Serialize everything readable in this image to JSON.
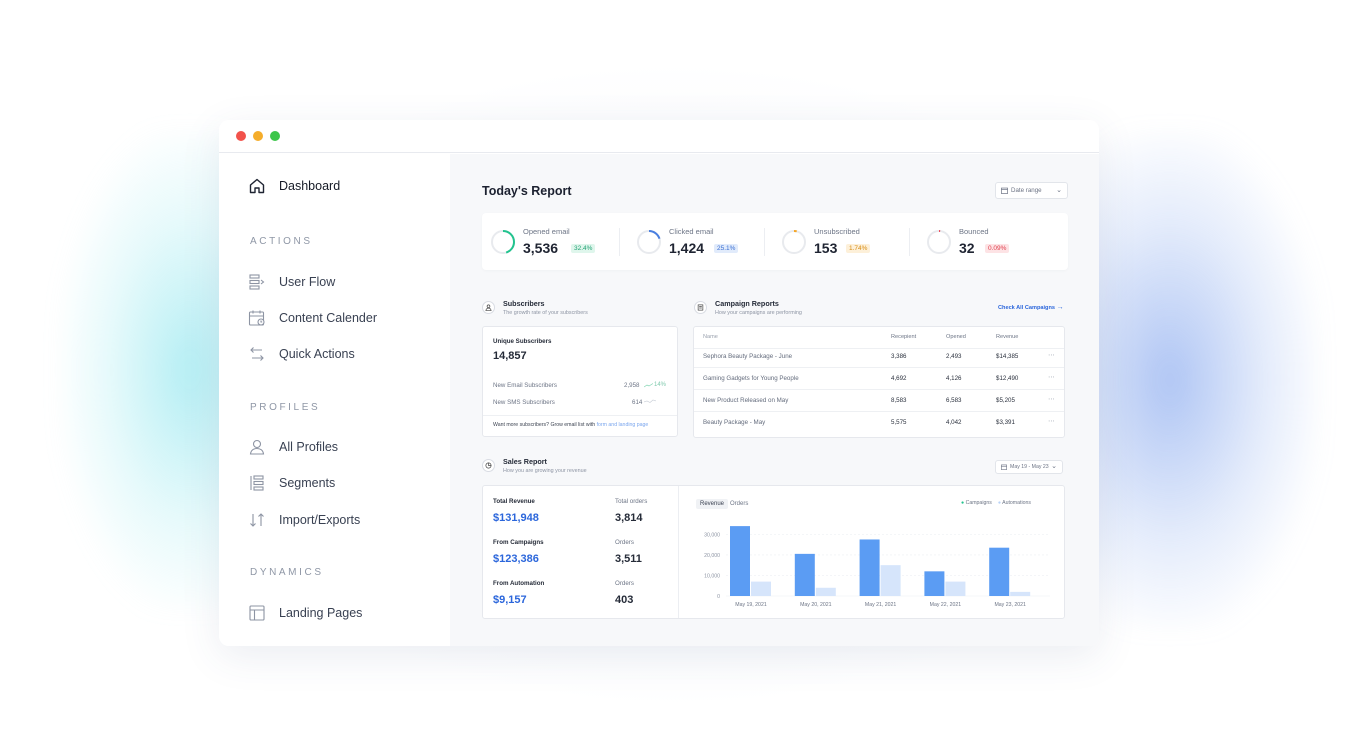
{
  "sidebar": {
    "dashboard": "Dashboard",
    "sections": {
      "actions": "ACTIONS",
      "profiles": "PROFILES",
      "dynamics": "DYNAMICS"
    },
    "items": {
      "user_flow": "User Flow",
      "content_calendar": "Content Calender",
      "quick_actions": "Quick Actions",
      "all_profiles": "All Profiles",
      "segments": "Segments",
      "import_exports": "Import/Exports",
      "landing_pages": "Landing Pages"
    }
  },
  "header": {
    "title": "Today's Report",
    "date_range": "Date range"
  },
  "kpis": [
    {
      "label": "Opened email",
      "value": "3,536",
      "badge": "32.4%",
      "ring_fraction": 0.45,
      "color": "#22c38e",
      "badge_bg": "#dff6ec",
      "badge_fg": "#22a274"
    },
    {
      "label": "Clicked email",
      "value": "1,424",
      "badge": "25.1%",
      "ring_fraction": 0.2,
      "color": "#4a7fe0",
      "badge_bg": "#e1ebfb",
      "badge_fg": "#3a6fd3"
    },
    {
      "label": "Unsubscribed",
      "value": "153",
      "badge": "1.74%",
      "ring_fraction": 0.04,
      "color": "#f5a524",
      "badge_bg": "#fdf0d9",
      "badge_fg": "#d88c12"
    },
    {
      "label": "Bounced",
      "value": "32",
      "badge": "0.09%",
      "ring_fraction": 0.01,
      "color": "#ef4b5a",
      "badge_bg": "#fde3e5",
      "badge_fg": "#e0404e"
    }
  ],
  "subscribers": {
    "title": "Subscribers",
    "subtitle": "The growth rate of your subscribers",
    "unique_label": "Unique Subscribers",
    "unique_value": "14,857",
    "new_email_label": "New Email Subscribers",
    "new_email_value": "2,958",
    "new_email_change": "14%",
    "new_sms_label": "New SMS Subscribers",
    "new_sms_value": "614",
    "footer_text": "Want more subscribers? Grow email list with",
    "footer_link": "form and landing page"
  },
  "campaigns": {
    "title": "Campaign Reports",
    "subtitle": "How your campaigns are performing",
    "link": "Check All Campaigns",
    "columns": [
      "Name",
      "Recepient",
      "Opened",
      "Revenue"
    ],
    "rows": [
      {
        "name": "Sephora Beauty Package - June",
        "recipient": "3,386",
        "opened": "2,493",
        "revenue": "$14,385"
      },
      {
        "name": "Gaming Gadgets for Young People",
        "recipient": "4,692",
        "opened": "4,126",
        "revenue": "$12,490"
      },
      {
        "name": "New Product Released on May",
        "recipient": "8,583",
        "opened": "6,583",
        "revenue": "$5,205"
      },
      {
        "name": "Beauty Package - May",
        "recipient": "5,575",
        "opened": "4,042",
        "revenue": "$3,391"
      }
    ]
  },
  "sales": {
    "title": "Sales Report",
    "subtitle": "How you are growing your revenue",
    "date_range": "May 19 - May 23",
    "total_revenue_label": "Total Revenue",
    "total_revenue": "$131,948",
    "total_orders_label": "Total orders",
    "total_orders": "3,814",
    "from_campaigns_label": "From Campaigns",
    "from_campaigns": "$123,386",
    "campaign_orders_label": "Orders",
    "campaign_orders": "3,511",
    "from_automation_label": "From Automation",
    "from_automation": "$9,157",
    "automation_orders_label": "Orders",
    "automation_orders": "403",
    "tabs": [
      "Revenue",
      "Orders"
    ]
  },
  "chart_data": {
    "type": "bar",
    "categories": [
      "May 19, 2021",
      "May 20, 2021",
      "May 21, 2021",
      "May 22, 2021",
      "May 23, 2021"
    ],
    "series": [
      {
        "name": "Campaigns",
        "color": "#5b9cf3",
        "values": [
          34000,
          20500,
          27500,
          12000,
          23500
        ]
      },
      {
        "name": "Automations",
        "color": "#d6e5fb",
        "values": [
          7000,
          4000,
          15000,
          7000,
          2000
        ]
      }
    ],
    "yticks": [
      "0",
      "10,000",
      "20,000",
      "30,000"
    ],
    "ylim": [
      0,
      36000
    ],
    "legend": "top-right"
  }
}
